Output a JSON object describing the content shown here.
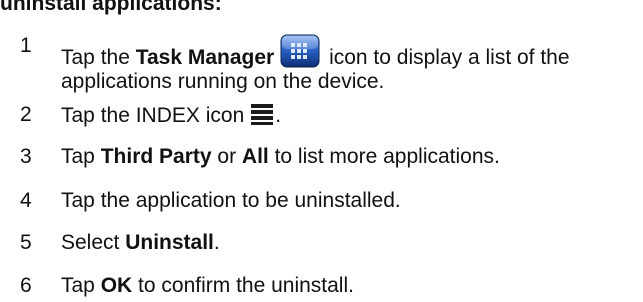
{
  "heading": "uninstall applications:",
  "colors": {
    "text": "#111111",
    "task_manager_icon_blue": "#2a63c9",
    "index_icon": "#1a1a1a"
  },
  "icons": {
    "task_manager": "task-manager-grid-icon",
    "index": "index-list-icon"
  },
  "steps": [
    {
      "number": "1",
      "pre": "Tap the ",
      "bold": "Task Manager",
      "post": " icon to display a list of the",
      "line2": "applications running on the device."
    },
    {
      "number": "2",
      "pre": "Tap the INDEX icon",
      "post": "."
    },
    {
      "number": "3",
      "pre": "Tap ",
      "bold1": "Third Party",
      "mid": " or ",
      "bold2": "All",
      "post": " to list more applications."
    },
    {
      "number": "4",
      "text": "Tap the application to be uninstalled."
    },
    {
      "number": "5",
      "pre": "Select ",
      "bold": "Uninstall",
      "post": "."
    },
    {
      "number": "6",
      "pre": "Tap ",
      "bold": "OK",
      "post": " to confirm the uninstall."
    }
  ]
}
